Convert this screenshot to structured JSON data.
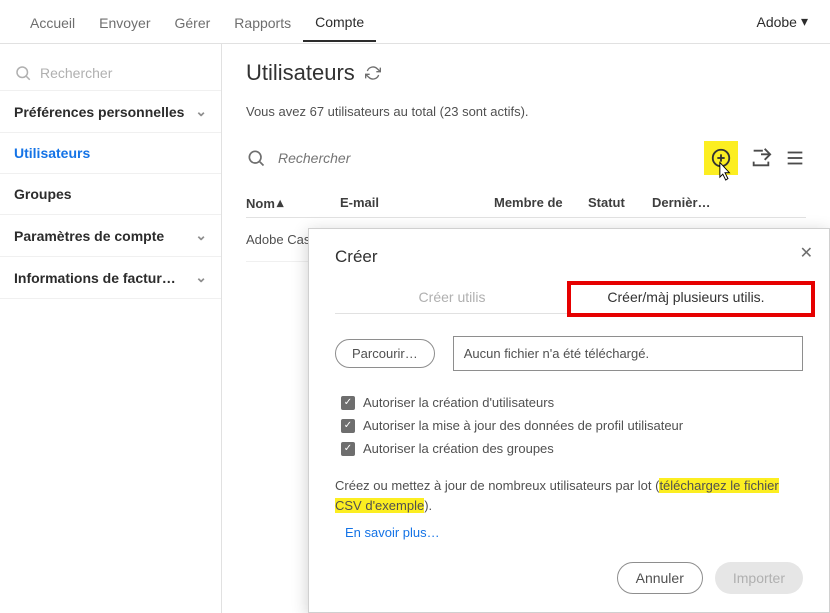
{
  "topnav": {
    "tabs": [
      "Accueil",
      "Envoyer",
      "Gérer",
      "Rapports",
      "Compte"
    ],
    "brand": "Adobe"
  },
  "sidebar": {
    "search_placeholder": "Rechercher",
    "items": [
      {
        "label": "Préférences personnelles",
        "has_chevron": true
      },
      {
        "label": "Utilisateurs",
        "active": true
      },
      {
        "label": "Groupes"
      },
      {
        "label": "Paramètres de compte",
        "has_chevron": true
      },
      {
        "label": "Informations de factur…",
        "has_chevron": true
      }
    ]
  },
  "page": {
    "title": "Utilisateurs",
    "subtitle": "Vous avez 67 utilisateurs au total (23 sont actifs).",
    "search_placeholder": "Rechercher",
    "columns": {
      "name": "Nom",
      "email": "E-mail",
      "member": "Membre de",
      "status": "Statut",
      "last": "Dernièr…"
    },
    "row0": "Adobe Cas"
  },
  "modal": {
    "title": "Créer",
    "tab_left": "Créer utilis",
    "tab_right": "Créer/màj plusieurs utilis.",
    "browse": "Parcourir…",
    "file_status": "Aucun fichier n'a été téléchargé.",
    "cb1": "Autoriser la création d'utilisateurs",
    "cb2": "Autoriser la mise à jour des données de profil utilisateur",
    "cb3": "Autoriser la création des groupes",
    "para_pre": "Créez ou mettez à jour de nombreux utilisateurs par lot (",
    "para_hl": "téléchargez le fichier CSV d'exemple",
    "para_post": ").",
    "learn_more": "En savoir plus…",
    "cancel": "Annuler",
    "import": "Importer"
  }
}
